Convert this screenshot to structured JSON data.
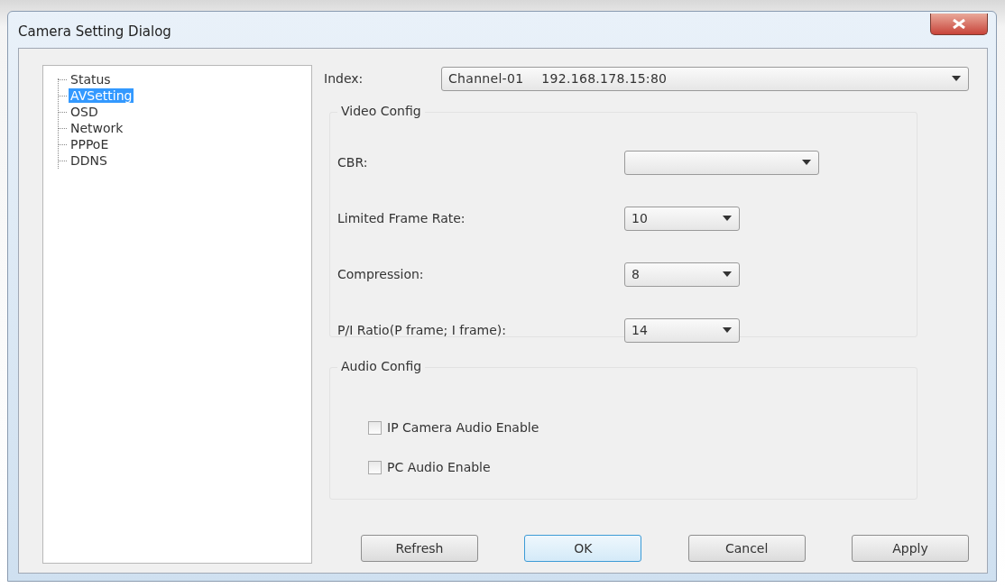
{
  "window": {
    "title": "Camera Setting Dialog"
  },
  "tree": {
    "items": [
      {
        "label": "Status",
        "selected": false
      },
      {
        "label": "AVSetting",
        "selected": true
      },
      {
        "label": "OSD",
        "selected": false
      },
      {
        "label": "Network",
        "selected": false
      },
      {
        "label": "PPPoE",
        "selected": false
      },
      {
        "label": "DDNS",
        "selected": false
      }
    ]
  },
  "index": {
    "label": "Index:",
    "channel": "Channel-01",
    "address": "192.168.178.15:80"
  },
  "video_config": {
    "title": "Video Config",
    "fields": [
      {
        "label": "CBR:",
        "wide": true
      },
      {
        "label": "Limited Frame Rate:",
        "value": "10",
        "wide": false
      },
      {
        "label": "Compression:",
        "value": "8",
        "wide": false
      },
      {
        "label": "P/I Ratio(P frame; I frame):",
        "value": "14",
        "wide": false
      }
    ]
  },
  "audio_config": {
    "title": "Audio Config",
    "options": [
      {
        "label": "IP Camera Audio Enable",
        "checked": false
      },
      {
        "label": "PC Audio Enable",
        "checked": false
      }
    ]
  },
  "buttons": [
    {
      "label": "Refresh",
      "focused": false
    },
    {
      "label": "OK",
      "focused": true
    },
    {
      "label": "Cancel",
      "focused": false
    },
    {
      "label": "Apply",
      "focused": false
    }
  ]
}
